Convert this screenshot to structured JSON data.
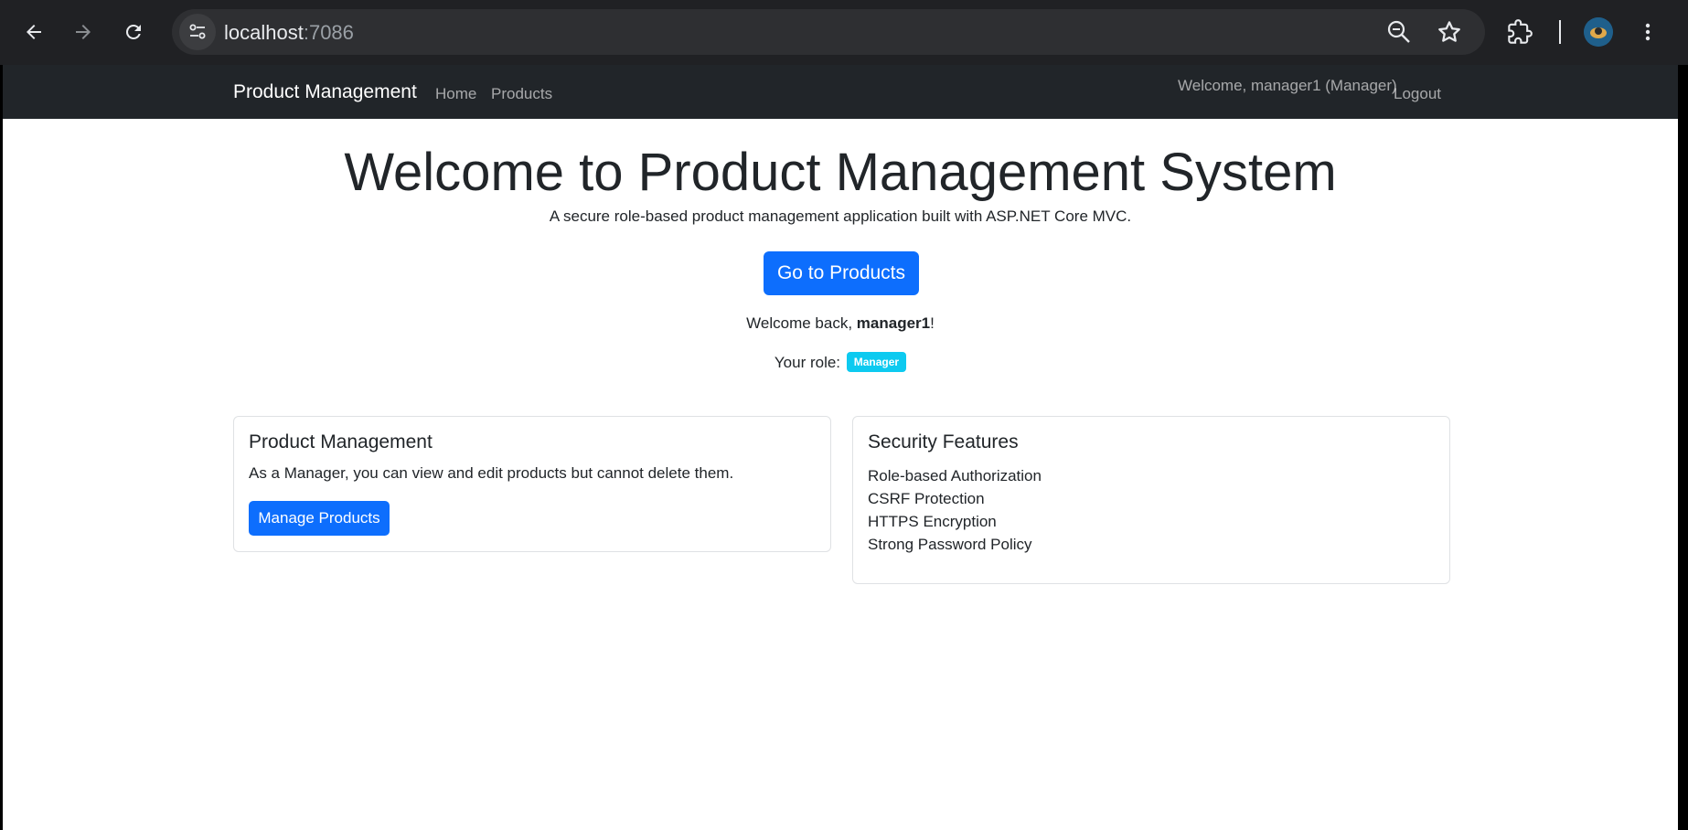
{
  "browser": {
    "url_host": "localhost",
    "url_port": ":7086"
  },
  "navbar": {
    "brand": "Product Management",
    "links": [
      "Home",
      "Products"
    ],
    "welcome": "Welcome, manager1 (Manager)",
    "logout": "Logout"
  },
  "hero": {
    "title": "Welcome to Product Management System",
    "subtitle": "A secure role-based product management application built with ASP.NET Core MVC.",
    "cta": "Go to Products",
    "welcome_prefix": "Welcome back, ",
    "username": "manager1",
    "welcome_suffix": "!",
    "role_label": "Your role: ",
    "role_badge": "Manager",
    "role_badge_color": "#0dcaf0"
  },
  "cards": {
    "product": {
      "title": "Product Management",
      "text": "As a Manager, you can view and edit products but cannot delete them.",
      "button": "Manage Products"
    },
    "security": {
      "title": "Security Features",
      "items": [
        "Role-based Authorization",
        "CSRF Protection",
        "HTTPS Encryption",
        "Strong Password Policy"
      ]
    }
  },
  "colors": {
    "primary": "#0d6efd",
    "navbar_bg": "#212529",
    "chrome_bg": "#202124"
  }
}
